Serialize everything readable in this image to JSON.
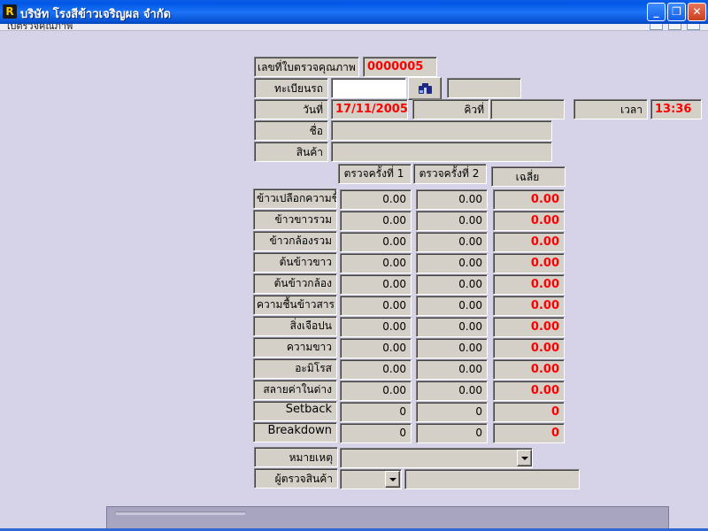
{
  "window": {
    "title": "บริษัท โรงสีข้าวเจริญผล จำกัด",
    "icon_letter": "R",
    "minimize_glyph": "_",
    "restore_glyph": "❐",
    "close_glyph": "✕"
  },
  "child_window": {
    "title": "ใบตรวจคุณภาพ"
  },
  "colors": {
    "highlight_value": "#ff0000",
    "form_bg": "#d6d3e8",
    "control_face": "#d4d0c8"
  },
  "form": {
    "doc_no_label": "เลขที่ใบตรวจคุณภาพ",
    "doc_no_value": "0000005",
    "plate_label": "ทะเบียนรถ",
    "plate_value": "",
    "plate_extra": "",
    "date_label": "วันที่",
    "date_value": "17/11/2005",
    "queue_label": "คิวที่",
    "queue_value": "",
    "time_label": "เวลา",
    "time_value": "13:36",
    "name_label": "ชื่อ",
    "name_value": "",
    "product_label": "สินค้า",
    "product_value": ""
  },
  "table": {
    "headers": [
      "ตรวจครั้งที่ 1",
      "ตรวจครั้งที่ 2",
      "เฉลี่ย"
    ],
    "rows": [
      {
        "label": "ข้าวเปลือกความชื้น",
        "v1": "0.00",
        "v2": "0.00",
        "avg": "0.00"
      },
      {
        "label": "ข้าวขาวรวม",
        "v1": "0.00",
        "v2": "0.00",
        "avg": "0.00"
      },
      {
        "label": "ข้าวกล้องรวม",
        "v1": "0.00",
        "v2": "0.00",
        "avg": "0.00"
      },
      {
        "label": "ต้นข้าวขาว",
        "v1": "0.00",
        "v2": "0.00",
        "avg": "0.00"
      },
      {
        "label": "ต้นข้าวกล้อง",
        "v1": "0.00",
        "v2": "0.00",
        "avg": "0.00"
      },
      {
        "label": "ความชื้นข้าวสาร",
        "v1": "0.00",
        "v2": "0.00",
        "avg": "0.00"
      },
      {
        "label": "สิ่งเจือปน",
        "v1": "0.00",
        "v2": "0.00",
        "avg": "0.00"
      },
      {
        "label": "ความขาว",
        "v1": "0.00",
        "v2": "0.00",
        "avg": "0.00"
      },
      {
        "label": "อะมิโรส",
        "v1": "0.00",
        "v2": "0.00",
        "avg": "0.00"
      },
      {
        "label": "สลายค่าในด่าง",
        "v1": "0.00",
        "v2": "0.00",
        "avg": "0.00"
      },
      {
        "label": "Setback",
        "v1": "0",
        "v2": "0",
        "avg": "0"
      },
      {
        "label": "Breakdown",
        "v1": "0",
        "v2": "0",
        "avg": "0"
      }
    ]
  },
  "footer": {
    "remark_label": "หมายเหตุ",
    "remark_value": "",
    "inspector_label": "ผู้ตรวจสินค้า",
    "inspector_code": "",
    "inspector_name": ""
  },
  "icons": {
    "find": "binoculars-icon",
    "dropdown": "chevron-down-icon"
  }
}
